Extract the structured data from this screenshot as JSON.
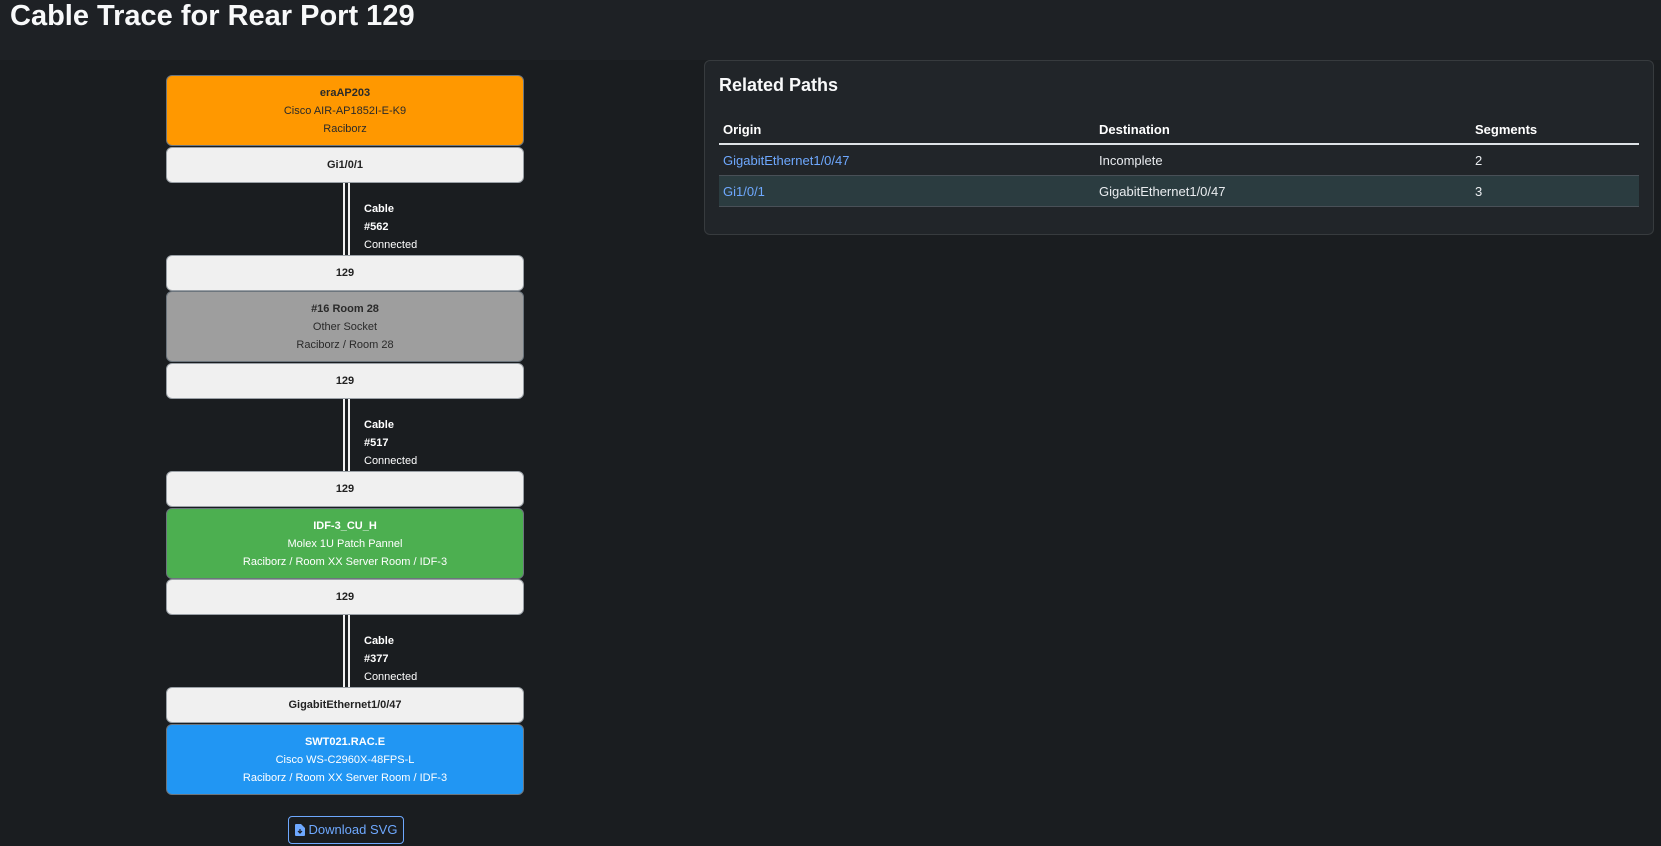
{
  "page": {
    "title": "Cable Trace for Rear Port 129"
  },
  "trace": {
    "devices": [
      {
        "name": "eraAP203",
        "type": "Cisco AIR-AP1852I-E-K9",
        "location": "Raciborz"
      },
      {
        "name": "#16 Room 28",
        "type": "Other Socket",
        "location": "Raciborz / Room 28"
      },
      {
        "name": "IDF-3_CU_H",
        "type": "Molex 1U Patch Pannel",
        "location": "Raciborz / Room XX Server Room / IDF-3"
      },
      {
        "name": "SWT021.RAC.E",
        "type": "Cisco WS-C2960X-48FPS-L",
        "location": "Raciborz / Room XX Server Room / IDF-3"
      }
    ],
    "ports": [
      "Gi1/0/1",
      "129",
      "129",
      "129",
      "129",
      "GigabitEthernet1/0/47"
    ],
    "cables": [
      {
        "id": "Cable #562",
        "status": "Connected"
      },
      {
        "id": "Cable #517",
        "status": "Connected"
      },
      {
        "id": "Cable #377",
        "status": "Connected"
      }
    ],
    "download_label": "Download SVG"
  },
  "related": {
    "title": "Related Paths",
    "headers": [
      "Origin",
      "Destination",
      "Segments"
    ],
    "rows": [
      {
        "origin": "GigabitEthernet1/0/47",
        "destination": "Incomplete",
        "segments": "2"
      },
      {
        "origin": "Gi1/0/1",
        "destination": "GigabitEthernet1/0/47",
        "segments": "3"
      }
    ]
  },
  "colors": {
    "ap": "#ff9800",
    "socket": "#9e9e9e",
    "patch": "#4caf50",
    "switch": "#2196f3",
    "link": "#6ea8fe"
  }
}
